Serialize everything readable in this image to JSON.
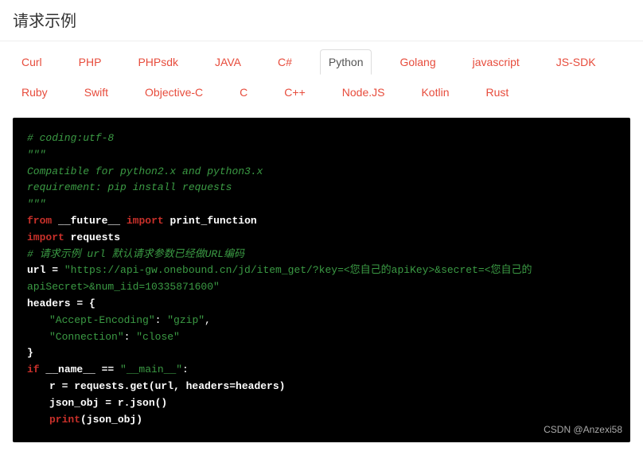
{
  "header": {
    "title": "请求示例"
  },
  "tabs": [
    "Curl",
    "PHP",
    "PHPsdk",
    "JAVA",
    "C#",
    "Python",
    "Golang",
    "javascript",
    "JS-SDK",
    "Ruby",
    "Swift",
    "Objective-C",
    "C",
    "C++",
    "Node.JS",
    "Kotlin",
    "Rust"
  ],
  "active_tab": "Python",
  "code": {
    "c1": "# coding:utf-8",
    "c2": "\"\"\"",
    "c3": "Compatible for python2.x and python3.x",
    "c4": "requirement: pip install requests",
    "c5": "\"\"\"",
    "kw_from": "from",
    "mod_future": "__future__",
    "kw_import": "import",
    "fn_print": "print_function",
    "mod_requests": "requests",
    "c6": "# 请求示例 url 默认请求参数已经做URL编码",
    "lbl_url": "url = ",
    "url_str": "\"https://api-gw.onebound.cn/jd/item_get/?key=<您自己的apiKey>&secret=<您自己的apiSecret>&num_iid=10335871600\"",
    "lbl_headers": "headers = {",
    "h1k": "\"Accept-Encoding\"",
    "colon": ": ",
    "h1v": "\"gzip\"",
    "comma": ",",
    "h2k": "\"Connection\"",
    "h2v": "\"close\"",
    "brace_close": "}",
    "kw_if": "if",
    "name_var": " __name__ ",
    "eq": "== ",
    "main_str": "\"__main__\"",
    "colon2": ":",
    "l_req": "r = requests.get(url, headers=headers)",
    "l_json": "json_obj = r.json()",
    "kw_print": "print",
    "l_print_arg": "(json_obj)"
  },
  "watermark": "CSDN @Anzexi58"
}
